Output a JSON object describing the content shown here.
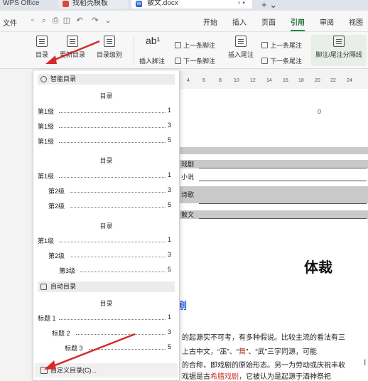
{
  "titlebar": {
    "app_name": "WPS Office",
    "tab1_label": "找稻壳模板",
    "tab2_label": "散文.docx",
    "tab2_icon_letter": "W",
    "tab2_close": "▫ •",
    "new_tab": "+ ⌄"
  },
  "menubar": {
    "file_label": "文件",
    "tabs": [
      "开始",
      "插入",
      "页面",
      "引用",
      "审阅",
      "视图"
    ],
    "active_tab": "引用"
  },
  "ribbon": {
    "toc": "目录",
    "update_toc": "更新目录",
    "toc_level": "目录级别",
    "insert_footnote": "插入脚注",
    "prev_footnote": "上一条脚注",
    "next_footnote": "下一条脚注",
    "insert_endnote": "插入尾注",
    "prev_endnote": "上一条尾注",
    "next_endnote": "下一条尾注",
    "separator_line": "脚注/尾注分隔线"
  },
  "ruler": [
    "4",
    "6",
    "8",
    "10",
    "12",
    "14",
    "16",
    "18",
    "20",
    "22",
    "24"
  ],
  "document": {
    "zero_mark": "0",
    "band_texts": [
      "戏剧",
      "小说",
      "诗歌",
      "散文"
    ],
    "heading": "体裁",
    "blue_mark": "剧",
    "body_lines": [
      {
        "pre": "的起源实不可考，有多种假说。比较主流的看法有三",
        "red": "",
        "post": ""
      },
      {
        "pre": "上古中文，“巫”、“",
        "red": "舞",
        "post": "”、“武”三字同源，可能"
      },
      {
        "pre": "的合称，即戏剧的原始形态。另一为劳动或庆祝丰收",
        "red": "",
        "post": ""
      },
      {
        "pre": "戏据是古",
        "red": "希腊戏剧",
        "post": "，它被认为是起源于酒神祭祀"
      }
    ]
  },
  "toc_panel": {
    "smart_section": "智能目录",
    "auto_section": "自动目录",
    "custom_label": "自定义目录(C)...",
    "groups": [
      {
        "title": "目录",
        "lines": [
          {
            "label": "第1级",
            "page": "1"
          },
          {
            "label": "第1级",
            "page": "3"
          },
          {
            "label": "第1级",
            "page": "5"
          }
        ]
      },
      {
        "title": "目录",
        "lines": [
          {
            "label": "第1级",
            "page": "1"
          },
          {
            "label": "第2级",
            "page": "3"
          },
          {
            "label": "第2级",
            "page": "5"
          }
        ]
      },
      {
        "title": "目录",
        "lines": [
          {
            "label": "第1级",
            "page": "1"
          },
          {
            "label": "第2级",
            "page": "3"
          },
          {
            "label": "第3级",
            "page": "5"
          }
        ]
      },
      {
        "title": "目录",
        "lines": [
          {
            "label": "标题 1",
            "page": "1"
          },
          {
            "label": "标题 2",
            "page": "3"
          },
          {
            "label": "标题 3",
            "page": "5"
          }
        ]
      }
    ]
  },
  "colors": {
    "accent_green": "#1d8b45",
    "annotation_arrow": "#d62a2a",
    "band_grey": "#c9c9c9"
  }
}
